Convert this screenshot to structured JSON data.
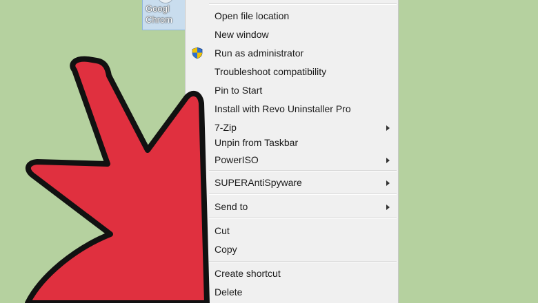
{
  "desktop_icon": {
    "label_line1": "Googl",
    "label_line2": "Chrom"
  },
  "context_menu": {
    "items": [
      {
        "label": "Open file location",
        "has_submenu": false
      },
      {
        "label": "New window",
        "has_submenu": false
      },
      {
        "label": "Run as administrator",
        "has_submenu": false,
        "icon": "uac-shield-icon"
      },
      {
        "label": "Troubleshoot compatibility",
        "has_submenu": false
      },
      {
        "label": "Pin to Start",
        "has_submenu": false
      },
      {
        "label": "Install with Revo Uninstaller Pro",
        "has_submenu": false
      },
      {
        "label": "7-Zip",
        "has_submenu": true
      },
      {
        "label": "Unpin from Taskbar",
        "has_submenu": false
      },
      {
        "label": "PowerISO",
        "has_submenu": true
      },
      {
        "label": "SUPERAntiSpyware",
        "has_submenu": true
      },
      {
        "label": "Send to",
        "has_submenu": true
      },
      {
        "label": "Cut",
        "has_submenu": false
      },
      {
        "label": "Copy",
        "has_submenu": false
      },
      {
        "label": "Create shortcut",
        "has_submenu": false
      },
      {
        "label": "Delete",
        "has_submenu": false
      }
    ]
  },
  "colors": {
    "desktop_background": "#b5d19f",
    "arrow_fill": "#e0303f",
    "arrow_outline": "#111111",
    "menu_background": "#f0f0f0"
  }
}
